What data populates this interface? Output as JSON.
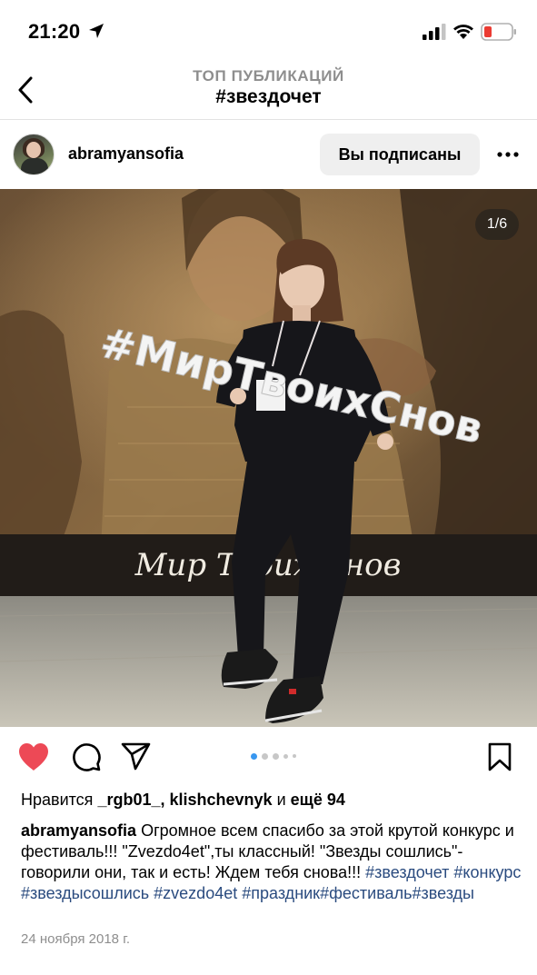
{
  "status": {
    "time": "21:20"
  },
  "nav": {
    "subtitle": "ТОП ПУБЛИКАЦИЙ",
    "title": "#звездочет"
  },
  "post": {
    "username": "abramyansofia",
    "follow_label": "Вы подписаны",
    "image_counter": "1/6",
    "carousel": {
      "total_dots": 5,
      "active_index": 0
    },
    "likes": {
      "prefix": "Нравится ",
      "user1": "_rgb01_",
      "sep": ", ",
      "user2": "klishchevnyk",
      "and": " и ",
      "more": "ещё 94"
    },
    "caption": {
      "author": "abramyansofia",
      "text": " Огромное всем спасибо за этой крутой конкурс и фестиваль!!! \"Zvezdo4et\",ты классный! \"Звезды сошлись\"-говорили они, так и есть! Ждем тебя снова!!! ",
      "tags": [
        "#звездочет",
        "#конкурс",
        "#звездысошлись",
        "#zvezdo4et",
        "#праздник",
        "#фестиваль",
        "#звезды"
      ]
    },
    "date": "24 ноября 2018 г.",
    "photo_text": {
      "sign": "#МирТвоихСнов",
      "banner": "Мир Твоих Снов"
    },
    "like_color": "#ed4956",
    "tag_color": "#2a4b7f"
  }
}
